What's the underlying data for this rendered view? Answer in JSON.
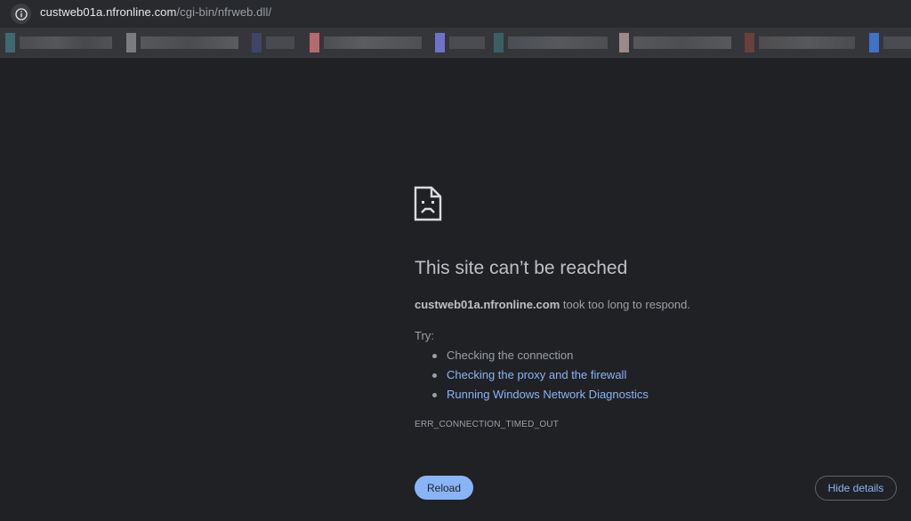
{
  "browser": {
    "address_host": "custweb01a.nfronline.com",
    "address_path": "/cgi-bin/nfrweb.dll/",
    "info_icon": "info-icon"
  },
  "error_page": {
    "icon": "sad-document-icon",
    "title": "This site can’t be reached",
    "host": "custweb01a.nfronline.com",
    "message_suffix": " took too long to respond.",
    "try_label": "Try:",
    "suggestions": [
      {
        "label": "Checking the connection",
        "link": false
      },
      {
        "label": "Checking the proxy and the firewall",
        "link": true
      },
      {
        "label": "Running Windows Network Diagnostics",
        "link": true
      }
    ],
    "error_code": "ERR_CONNECTION_TIMED_OUT",
    "reload_label": "Reload",
    "details_label": "Hide details"
  },
  "colors": {
    "background": "#202124",
    "link": "#8ab4f8",
    "button": "#8ab4f8"
  }
}
